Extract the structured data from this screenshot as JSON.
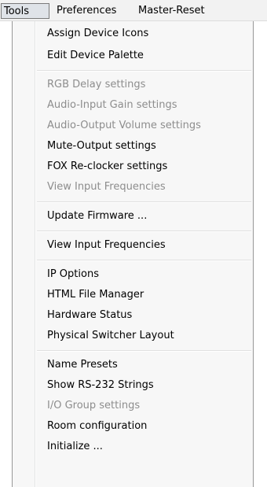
{
  "menubar": {
    "items": [
      {
        "label": "Tools"
      },
      {
        "label": "Preferences"
      },
      {
        "label": "Master-Reset"
      }
    ]
  },
  "menu": {
    "groups": [
      {
        "items": [
          {
            "label": "Assign Device Icons",
            "enabled": true
          },
          {
            "label": "Edit Device Palette",
            "enabled": true
          }
        ]
      },
      {
        "items": [
          {
            "label": "RGB Delay settings",
            "enabled": false
          },
          {
            "label": "Audio-Input Gain settings",
            "enabled": false
          },
          {
            "label": "Audio-Output Volume settings",
            "enabled": false
          },
          {
            "label": "Mute-Output settings",
            "enabled": true
          },
          {
            "label": "FOX Re-clocker settings",
            "enabled": true
          },
          {
            "label": "View Input Frequencies",
            "enabled": false
          }
        ]
      },
      {
        "items": [
          {
            "label": "Update Firmware ...",
            "enabled": true
          }
        ]
      },
      {
        "items": [
          {
            "label": "View Input Frequencies",
            "enabled": true
          }
        ]
      },
      {
        "items": [
          {
            "label": "IP Options",
            "enabled": true
          },
          {
            "label": "HTML File Manager",
            "enabled": true
          },
          {
            "label": "Hardware Status",
            "enabled": true
          },
          {
            "label": "Physical Switcher Layout",
            "enabled": true
          }
        ]
      },
      {
        "items": [
          {
            "label": "Name Presets",
            "enabled": true
          },
          {
            "label": "Show RS-232 Strings",
            "enabled": true
          },
          {
            "label": "I/O Group settings",
            "enabled": false
          },
          {
            "label": "Room configuration",
            "enabled": true
          },
          {
            "label": "Initialize ...",
            "enabled": true
          }
        ]
      }
    ]
  }
}
